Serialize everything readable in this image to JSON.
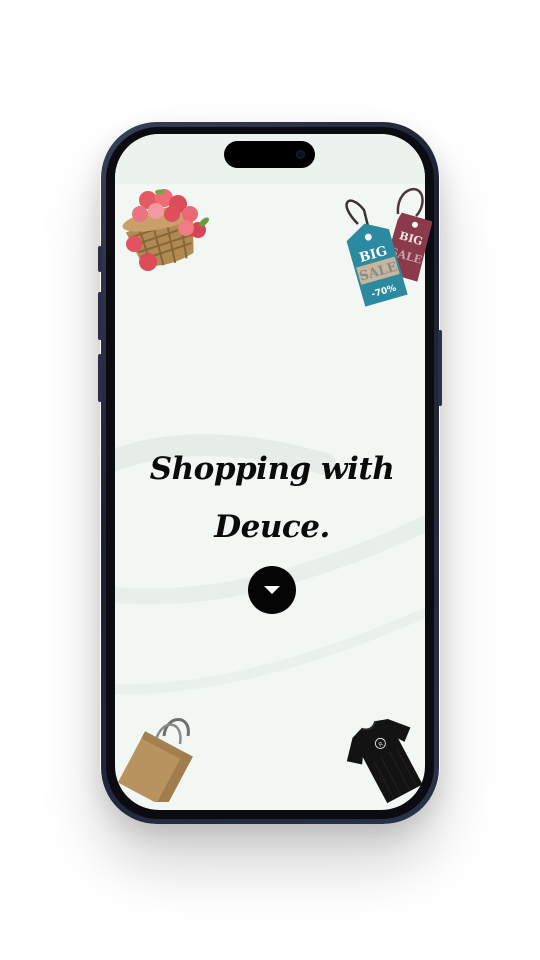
{
  "screen": {
    "headline_line1": "Shopping with",
    "headline_line2": "Deuce.",
    "scroll_button_icon": "caret-down-icon"
  },
  "decorations": {
    "sale_tag_front": {
      "line1": "BIG",
      "line2": "SALE",
      "line3": "-70%"
    },
    "sale_tag_back": {
      "line1": "BIG",
      "line2": "SALE"
    },
    "shirt_badge": "R"
  },
  "colors": {
    "background": "#f2f7f3",
    "headline": "#0a0a0a",
    "button": "#050505",
    "tag_teal": "#2b8aa0",
    "tag_maroon": "#8a3a48"
  }
}
